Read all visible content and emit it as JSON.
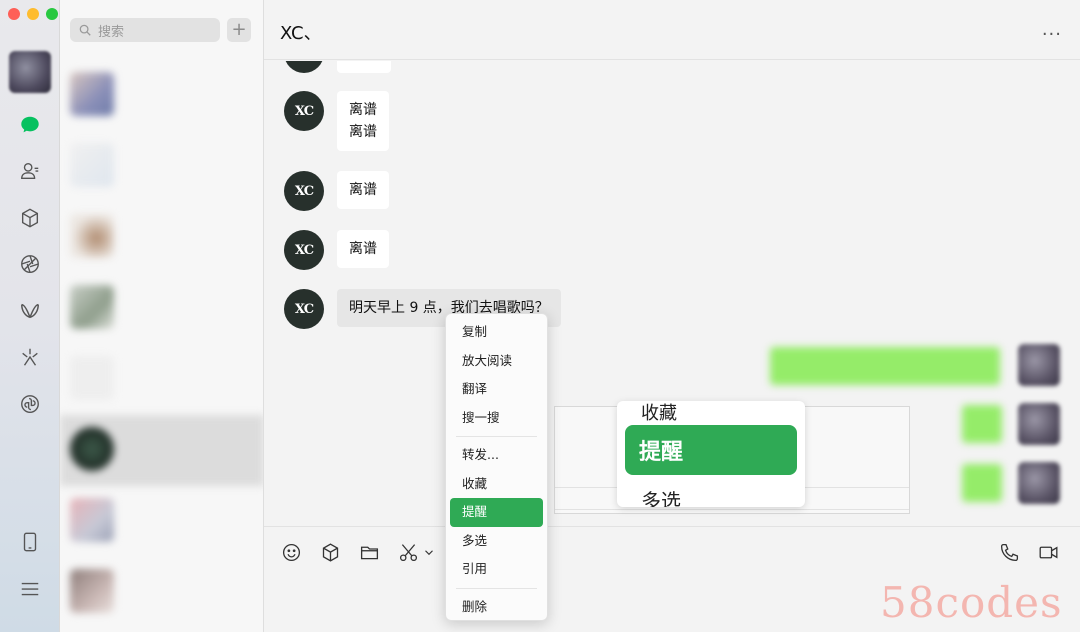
{
  "window": {
    "controls": [
      "close",
      "minimize",
      "zoom"
    ]
  },
  "rail": {
    "icons": [
      "chat-icon",
      "contacts-icon",
      "favorites-icon",
      "moments-icon",
      "channels-icon",
      "discover-icon",
      "mini-program-icon",
      "phone-icon",
      "menu-icon"
    ],
    "active_color": "#07c160"
  },
  "chatlist": {
    "search_placeholder": "搜索",
    "add_label": "+",
    "rows": [
      {
        "name": "",
        "snippet": "",
        "time": ""
      },
      {
        "name": "",
        "snippet": "",
        "time": ""
      },
      {
        "name": "",
        "snippet": "",
        "time": ""
      },
      {
        "name": "",
        "snippet": "",
        "time": ""
      },
      {
        "name": "",
        "snippet": "",
        "time": ""
      },
      {
        "name": "",
        "snippet": "",
        "time": ""
      },
      {
        "name": "",
        "snippet": "",
        "time": ""
      },
      {
        "name": "",
        "snippet": "",
        "time": ""
      }
    ]
  },
  "chat": {
    "title": "XC、",
    "more_label": "···",
    "avatar_text": "XC",
    "messages": [
      {
        "from": "XC",
        "text": "离谱\n离谱"
      },
      {
        "from": "XC",
        "text": "离谱"
      },
      {
        "from": "XC",
        "text": "离谱"
      },
      {
        "from": "XC",
        "text": "明天早上 9 点，我们去唱歌吗？"
      }
    ]
  },
  "zoom_preview": {
    "top_label": "收藏",
    "highlight_label": "提醒",
    "bottom_label": "多选"
  },
  "context_menu": {
    "groups": [
      [
        "复制",
        "放大阅读",
        "翻译",
        "搜一搜"
      ],
      [
        "转发...",
        "收藏",
        "提醒",
        "多选",
        "引用"
      ],
      [
        "删除"
      ]
    ],
    "selected": "提醒",
    "accent": "#2faa55"
  },
  "toolbar": {
    "left_tools": [
      "emoji-icon",
      "favorites-icon",
      "folder-icon",
      "scissors-icon",
      "chevron-down-icon"
    ],
    "right_tools": [
      "phone-call-icon",
      "video-call-icon"
    ]
  },
  "watermark": "58codes"
}
